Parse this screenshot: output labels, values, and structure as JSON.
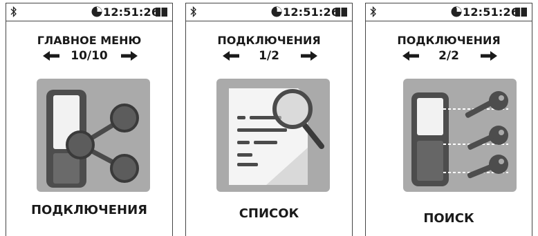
{
  "screens": [
    {
      "status": {
        "time": "12:51:26",
        "bluetooth_icon": "bluetooth-icon",
        "clock_icon": "clock-icon",
        "battery_icon": "battery-icon"
      },
      "title": "ГЛАВНОЕ МЕНЮ",
      "page": "10/10",
      "icon": "share-device-icon",
      "label": "ПОДКЛЮЧЕНИЯ"
    },
    {
      "status": {
        "time": "12:51:26",
        "bluetooth_icon": "bluetooth-icon",
        "clock_icon": "clock-icon",
        "battery_icon": "battery-icon"
      },
      "title": "ПОДКЛЮЧЕНИЯ",
      "page": "1/2",
      "icon": "document-search-icon",
      "label": "СПИСОК"
    },
    {
      "status": {
        "time": "12:51:26",
        "bluetooth_icon": "bluetooth-icon",
        "clock_icon": "clock-icon",
        "battery_icon": "battery-icon"
      },
      "title": "ПОДКЛЮЧЕНИЯ",
      "page": "2/2",
      "icon": "device-keys-icon",
      "label": "ПОИСК"
    }
  ],
  "colors": {
    "tile_bg": "#aaaaaa",
    "device_dark": "#555555",
    "device_screen": "#f2f2f2",
    "accent_dark": "#4a4a4a"
  }
}
